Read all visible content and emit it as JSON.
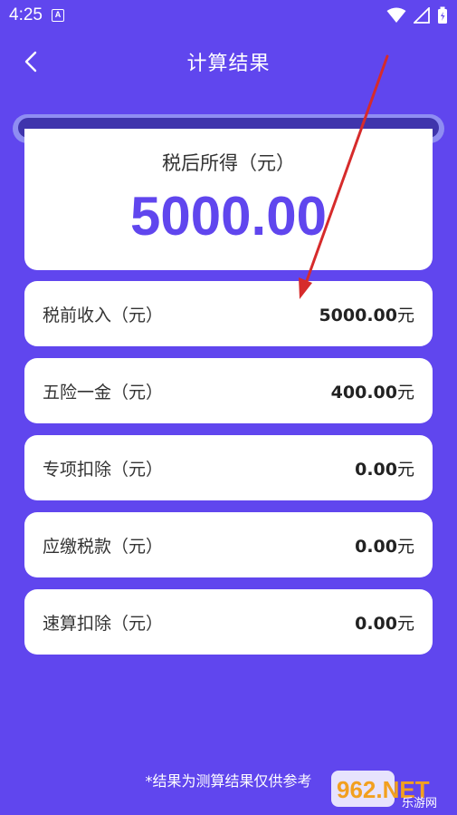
{
  "status_bar": {
    "time": "4:25",
    "notification_icon_letter": "A"
  },
  "app_bar": {
    "title": "计算结果"
  },
  "result": {
    "label": "税后所得（元）",
    "value": "5000.00"
  },
  "rows": [
    {
      "label": "税前收入（元）",
      "value": "5000.00",
      "unit": "元"
    },
    {
      "label": "五险一金（元）",
      "value": "400.00",
      "unit": "元"
    },
    {
      "label": "专项扣除（元）",
      "value": "0.00",
      "unit": "元"
    },
    {
      "label": "应缴税款（元）",
      "value": "0.00",
      "unit": "元"
    },
    {
      "label": "速算扣除（元）",
      "value": "0.00",
      "unit": "元"
    }
  ],
  "footer": {
    "note": "*结果为测算结果仅供参考"
  },
  "watermark": {
    "brand": "962.NET",
    "sub": "乐游网"
  },
  "colors": {
    "background": "#6046ee",
    "accent": "#6046ee",
    "annotation_arrow": "#d62b2b"
  }
}
